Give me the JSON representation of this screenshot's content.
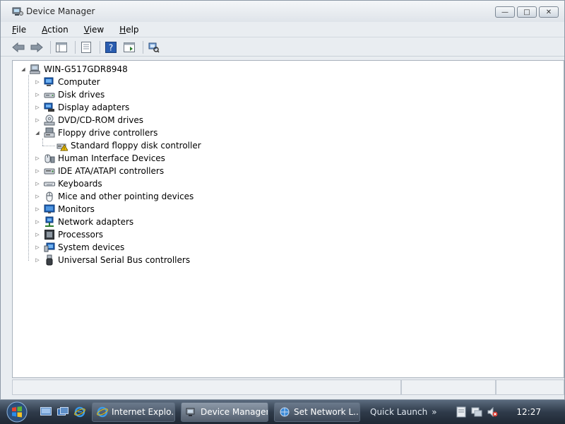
{
  "window": {
    "title": "Device Manager",
    "buttons": {
      "minimize": "—",
      "maximize": "□",
      "close": "✕"
    }
  },
  "menu": [
    {
      "label": "File",
      "u": "F",
      "rest": "ile"
    },
    {
      "label": "Action",
      "u": "A",
      "rest": "ction"
    },
    {
      "label": "View",
      "u": "V",
      "rest": "iew"
    },
    {
      "label": "Help",
      "u": "H",
      "rest": "elp"
    }
  ],
  "tree": {
    "root": "WIN-G517GDR8948",
    "items": [
      {
        "label": "Computer",
        "expander": "▷",
        "icon": "computer-icon"
      },
      {
        "label": "Disk drives",
        "expander": "▷",
        "icon": "disk-drive-icon"
      },
      {
        "label": "Display adapters",
        "expander": "▷",
        "icon": "display-adapter-icon"
      },
      {
        "label": "DVD/CD-ROM drives",
        "expander": "▷",
        "icon": "dvd-drive-icon"
      },
      {
        "label": "Floppy drive controllers",
        "expander": "◢",
        "icon": "floppy-controller-icon"
      },
      {
        "label": "Standard floppy disk controller",
        "expander": "",
        "icon": "floppy-warning-icon",
        "child": true
      },
      {
        "label": "Human Interface Devices",
        "expander": "▷",
        "icon": "hid-icon"
      },
      {
        "label": "IDE ATA/ATAPI controllers",
        "expander": "▷",
        "icon": "ide-controller-icon"
      },
      {
        "label": "Keyboards",
        "expander": "▷",
        "icon": "keyboard-icon"
      },
      {
        "label": "Mice and other pointing devices",
        "expander": "▷",
        "icon": "mouse-icon"
      },
      {
        "label": "Monitors",
        "expander": "▷",
        "icon": "monitor-icon"
      },
      {
        "label": "Network adapters",
        "expander": "▷",
        "icon": "network-adapter-icon"
      },
      {
        "label": "Processors",
        "expander": "▷",
        "icon": "processor-icon"
      },
      {
        "label": "System devices",
        "expander": "▷",
        "icon": "system-devices-icon"
      },
      {
        "label": "Universal Serial Bus controllers",
        "expander": "▷",
        "icon": "usb-icon"
      }
    ]
  },
  "taskbar": {
    "buttons": [
      {
        "label": "Internet Explo...",
        "icon": "ie-icon"
      },
      {
        "label": "Device Manager",
        "icon": "device-manager-icon",
        "active": true
      },
      {
        "label": "Set Network L...",
        "icon": "network-icon"
      }
    ],
    "quick_launch": "Quick Launch",
    "chevron": "»",
    "clock": "12:27"
  },
  "colors": {
    "accent": "#1e5fb4",
    "warning": "#f2c200"
  }
}
